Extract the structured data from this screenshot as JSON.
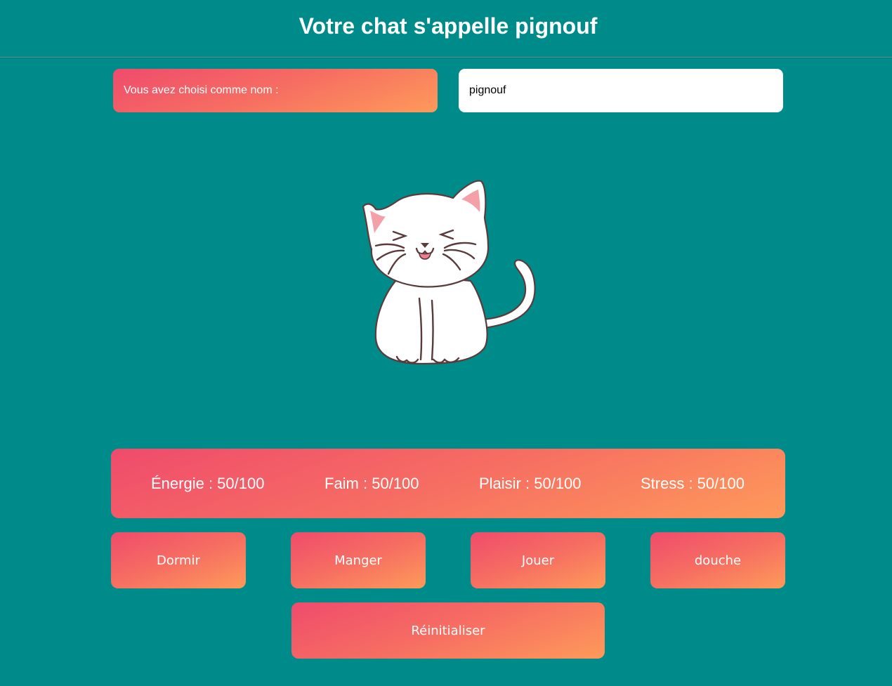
{
  "header": {
    "title": "Votre chat s'appelle pignouf"
  },
  "name_section": {
    "label": "Vous avez choisi comme nom :",
    "input_value": "pignouf"
  },
  "stats": [
    {
      "label": "Énergie : 50/100"
    },
    {
      "label": "Faim : 50/100"
    },
    {
      "label": "Plaisir : 50/100"
    },
    {
      "label": "Stress : 50/100"
    }
  ],
  "actions": {
    "sleep": "Dormir",
    "eat": "Manger",
    "play": "Jouer",
    "shower": "douche",
    "reset": "Réinitialiser"
  },
  "colors": {
    "background": "#008b8b",
    "gradient_start": "#ef4b6c",
    "gradient_end": "#fe9a5a",
    "text": "#ffffff"
  }
}
